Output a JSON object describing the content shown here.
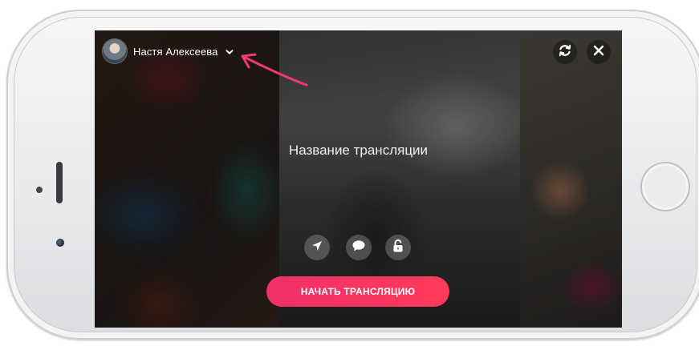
{
  "user": {
    "name": "Настя Алексеева",
    "dropdown_icon": "chevron-down-icon"
  },
  "broadcast": {
    "title_placeholder": "Название трансляции",
    "start_label": "НАЧАТЬ ТРАНСЛЯЦИЮ"
  },
  "controls": {
    "refresh_icon": "camera-switch-icon",
    "close_icon": "close-icon",
    "tools": [
      "location-arrow-icon",
      "comment-bubble-icon",
      "unlock-icon"
    ]
  },
  "colors": {
    "accent_gradient_start": "#f1306a",
    "accent_gradient_end": "#ff3a58",
    "annotation_arrow": "#f03a6b"
  }
}
